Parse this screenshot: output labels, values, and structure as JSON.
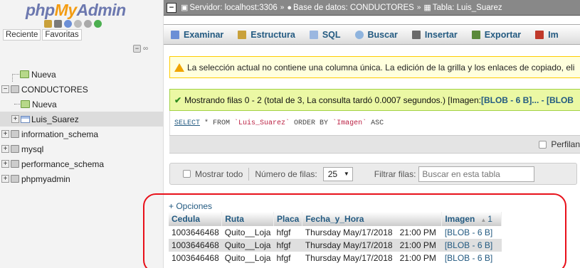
{
  "left": {
    "logo": {
      "php": "php",
      "my": "My",
      "admin": "Admin"
    },
    "tool_icons": [
      {
        "name": "home-icon",
        "color": "#c9a13b"
      },
      {
        "name": "logout-icon",
        "color": "#7a7a7a"
      },
      {
        "name": "query-icon",
        "color": "#6c8fd6"
      },
      {
        "name": "docs-icon",
        "color": "#bbbbbb"
      },
      {
        "name": "settings-icon",
        "color": "#aaaaaa"
      },
      {
        "name": "reload-icon",
        "color": "#4caf50"
      }
    ],
    "tabs": [
      "Reciente",
      "Favoritas"
    ],
    "tree": {
      "nueva": "Nueva",
      "db1": "CONDUCTORES",
      "db1_new": "Nueva",
      "db1_table": "Luis_Suarez",
      "db2": "information_schema",
      "db3": "mysql",
      "db4": "performance_schema",
      "db5": "phpmyadmin"
    }
  },
  "breadcrumb": {
    "server": "Servidor: localhost:3306",
    "database": "Base de datos: CONDUCTORES",
    "table": "Tabla: Luis_Suarez"
  },
  "menu": [
    {
      "label": "Examinar",
      "icon": "browse-icon",
      "color": "#6c8fd6"
    },
    {
      "label": "Estructura",
      "icon": "structure-icon",
      "color": "#c9a13b"
    },
    {
      "label": "SQL",
      "icon": "sql-icon",
      "color": "#9bb7e0"
    },
    {
      "label": "Buscar",
      "icon": "search-icon",
      "color": "#8fb4de"
    },
    {
      "label": "Insertar",
      "icon": "insert-icon",
      "color": "#6a6a6a"
    },
    {
      "label": "Exportar",
      "icon": "export-icon",
      "color": "#5b8a3a"
    },
    {
      "label": "Im",
      "icon": "import-icon",
      "color": "#c0392b"
    }
  ],
  "notice": "La selección actual no contiene una columna única. La edición de la grilla y los enlaces de copiado, eli",
  "success": {
    "text": "Mostrando filas 0 - 2 (total de 3, La consulta tardó 0.0007 segundos.) [Imagen: ",
    "bold": "[BLOB - 6 B]... - [BLOB"
  },
  "sql": {
    "kw": "SELECT",
    "rest1": " * FROM ",
    "table": "`Luis_Suarez`",
    "rest2": " ORDER BY ",
    "col": "`Imagen`",
    "rest3": " ASC"
  },
  "profiling": "Perfilan",
  "filter": {
    "show_all": "Mostrar todo",
    "rows_label": "Número de filas:",
    "rows_value": "25",
    "filter_label": "Filtrar filas:",
    "filter_placeholder": "Buscar en esta tabla"
  },
  "results": {
    "options": "+ Opciones",
    "sort_n": "1",
    "columns": [
      "Cedula",
      "Ruta",
      "Placa",
      "Fecha_y_Hora",
      "Imagen"
    ],
    "rows": [
      [
        "1003646468",
        "Quito__Loja",
        "hfgf",
        "Thursday May/17/2018   21:00 PM",
        "[BLOB - 6 B]"
      ],
      [
        "1003646468",
        "Quito__Loja",
        "hfgf",
        "Thursday May/17/2018   21:00 PM",
        "[BLOB - 6 B]"
      ],
      [
        "1003646468",
        "Quito__Loja",
        "hfgf",
        "Thursday May/17/2018   21:00 PM",
        "[BLOB - 6 B]"
      ]
    ]
  }
}
